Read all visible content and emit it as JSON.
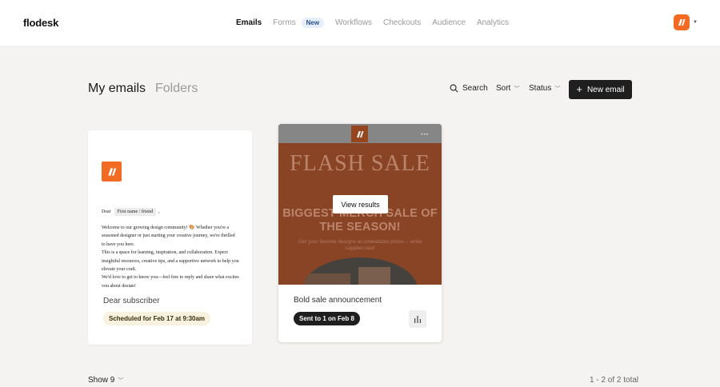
{
  "app": {
    "name": "flodesk"
  },
  "nav": {
    "items": [
      {
        "label": "Emails"
      },
      {
        "label": "Forms"
      },
      {
        "label": "Workflows"
      },
      {
        "label": "Checkouts"
      },
      {
        "label": "Audience"
      },
      {
        "label": "Analytics"
      }
    ],
    "forms_badge": "New"
  },
  "header": {
    "title": "My emails",
    "folders": "Folders",
    "search": "Search",
    "sort": "Sort",
    "status": "Status",
    "new_email": "New email"
  },
  "emails": [
    {
      "preview": {
        "dear": "Dear",
        "token": "First name / friend",
        "comma": ",",
        "paragraphs": [
          "Welcome to our growing design community! 🎨 Whether you're a seasoned designer or just starting your creative journey, we're thrilled to have you here.",
          "This is a space for learning, inspiration, and collaboration. Expect insightful resources, creative tips, and a supportive network to help you elevate your craft.",
          "We'd love to get to know you—feel free to reply and share what excites you about design!"
        ]
      },
      "name": "Dear subscriber",
      "status": "Scheduled for Feb 17 at 9:30am"
    },
    {
      "preview": {
        "headline": "FLASH SALE",
        "sub_headline": "BIGGEST MERCH SALE OF THE SEASON!",
        "subtext": "Get your favorite designs at unbeatable prices – while supplies last!",
        "more": "···",
        "view_results": "View results"
      },
      "name": "Bold sale announcement",
      "status": "Sent to 1 on Feb 8"
    }
  ],
  "footer": {
    "show": "Show 9",
    "total": "1 - 2 of 2 total"
  },
  "colors": {
    "brand": "#f26b22",
    "sale_bg": "#8a3d1a",
    "sale_text": "#c7866a",
    "dark": "#1f1f1f"
  }
}
